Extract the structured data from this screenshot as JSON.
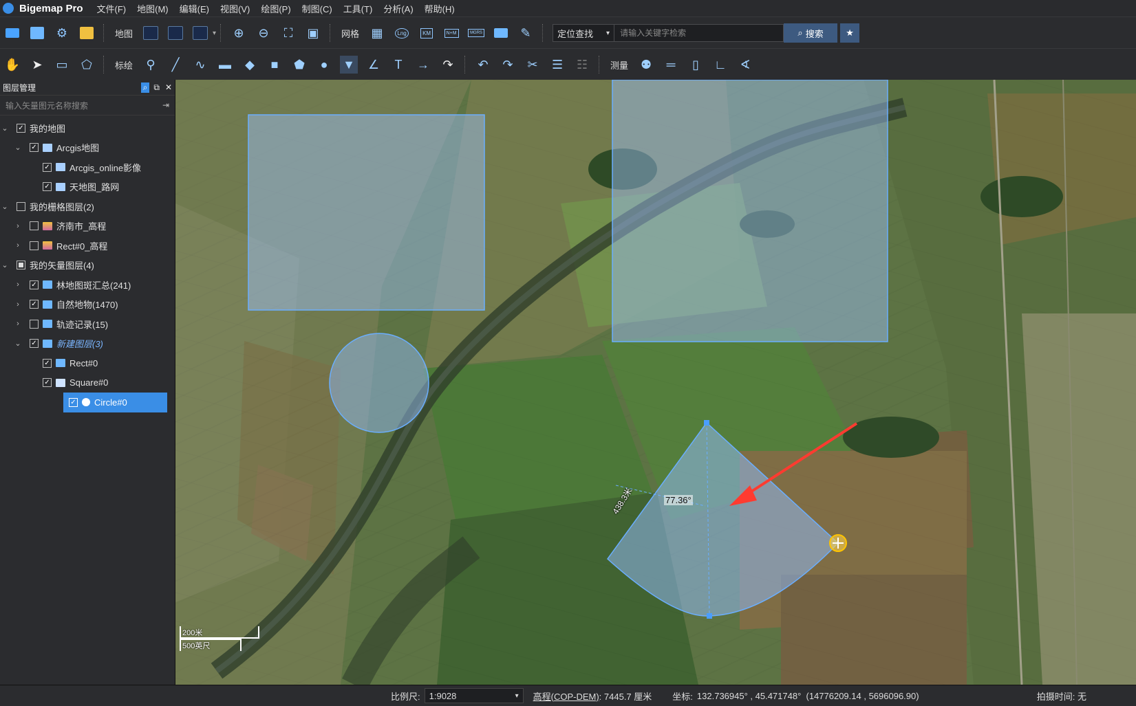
{
  "app": {
    "name": "Bigemap Pro",
    "menu": [
      "文件(F)",
      "地图(M)",
      "编辑(E)",
      "视图(V)",
      "绘图(P)",
      "制图(C)",
      "工具(T)",
      "分析(A)",
      "帮助(H)"
    ]
  },
  "toolbar1": {
    "map_label": "地图",
    "grid_label": "网格",
    "locate_select": "定位查找",
    "search_placeholder": "请输入关键字检索",
    "search_button": "搜索",
    "grid_icons": [
      "Lng",
      "KM",
      "N+M",
      "MGRS"
    ]
  },
  "toolbar2": {
    "annotate_label": "标绘",
    "measure_label": "测量"
  },
  "panel": {
    "title": "图层管理",
    "search_placeholder": "输入矢量图元名称搜索",
    "tree": [
      {
        "label": "我的地图",
        "level": 0,
        "expanded": true,
        "checked": "checked",
        "icon": "none"
      },
      {
        "label": "Arcgis地图",
        "level": 1,
        "expanded": true,
        "checked": "checked",
        "icon": "map"
      },
      {
        "label": "Arcgis_online影像",
        "level": 2,
        "checked": "checked",
        "icon": "map"
      },
      {
        "label": "天地图_路网",
        "level": 2,
        "checked": "checked",
        "icon": "map"
      },
      {
        "label": "我的栅格图层(2)",
        "level": 0,
        "expanded": true,
        "checked": "unchecked",
        "icon": "none"
      },
      {
        "label": "济南市_高程",
        "level": 1,
        "expanded": false,
        "checked": "unchecked",
        "icon": "raster"
      },
      {
        "label": "Rect#0_高程",
        "level": 1,
        "expanded": false,
        "checked": "unchecked",
        "icon": "raster"
      },
      {
        "label": "我的矢量图层(4)",
        "level": 0,
        "expanded": true,
        "checked": "partial",
        "icon": "none"
      },
      {
        "label": "林地图斑汇总(241)",
        "level": 1,
        "expanded": false,
        "checked": "checked",
        "icon": "layers"
      },
      {
        "label": "自然地物(1470)",
        "level": 1,
        "expanded": false,
        "checked": "checked",
        "icon": "layers"
      },
      {
        "label": "轨迹记录(15)",
        "level": 1,
        "expanded": false,
        "checked": "unchecked",
        "icon": "layers"
      },
      {
        "label": "新建图层(3)",
        "level": 1,
        "expanded": true,
        "checked": "checked",
        "icon": "layers",
        "active": true
      },
      {
        "label": "Rect#0",
        "level": 2,
        "checked": "checked",
        "icon": "rect"
      },
      {
        "label": "Square#0",
        "level": 2,
        "checked": "checked",
        "icon": "square"
      },
      {
        "label": "Circle#0",
        "level": 2,
        "checked": "checked",
        "icon": "circle",
        "selected": true
      }
    ]
  },
  "map": {
    "sector_radius_label": "438.3米",
    "sector_angle_label": "77.36°",
    "scalebar_metric": "200米",
    "scalebar_imperial": "500英尺"
  },
  "status": {
    "scale_label": "比例尺:",
    "scale_value": "1:9028",
    "elev_label": "高程(COP-DEM)",
    "elev_value": ": 7445.7 厘米",
    "coord_label": "坐标:",
    "coord_value": "132.736945° , 45.471748°  (14776209.14 , 5696096.90)",
    "capture_label": "拍摄时间: 无"
  },
  "colors": {
    "accent": "#3a8ee6",
    "overlay_fill": "#8fb8f0",
    "arrow": "#ff3b30"
  }
}
